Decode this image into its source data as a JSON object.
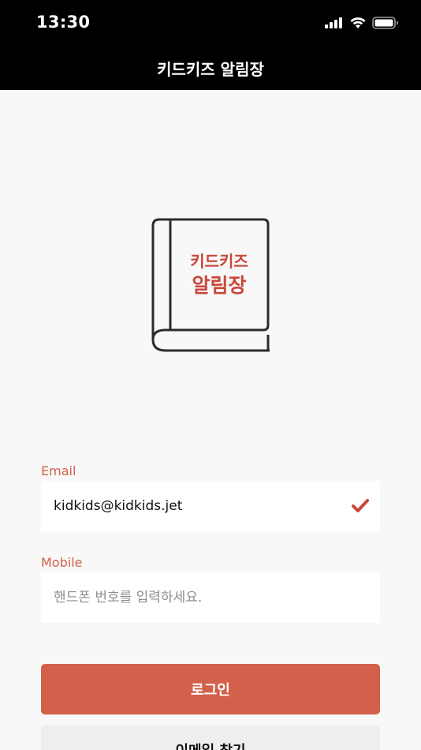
{
  "status_bar": {
    "time": "13:30",
    "icons": [
      "cellular-signal-icon",
      "wifi-icon",
      "battery-icon"
    ]
  },
  "nav": {
    "title": "키드키즈 알림장"
  },
  "logo": {
    "line1": "키드키즈",
    "line2": "알림장",
    "icon": "book-icon"
  },
  "form": {
    "email": {
      "label": "Email",
      "value": "kidkids@kidkids.jet",
      "icon": "check-icon"
    },
    "mobile": {
      "label": "Mobile",
      "placeholder": "핸드폰 번호를 입력하세요."
    }
  },
  "buttons": {
    "login_label": "로그인",
    "find_email_label": "이메일 찾기"
  },
  "colors": {
    "accent": "#d2604a",
    "header_bg": "#000000",
    "page_bg": "#f8f8f8",
    "secondary_button_bg": "#eeeeee"
  }
}
